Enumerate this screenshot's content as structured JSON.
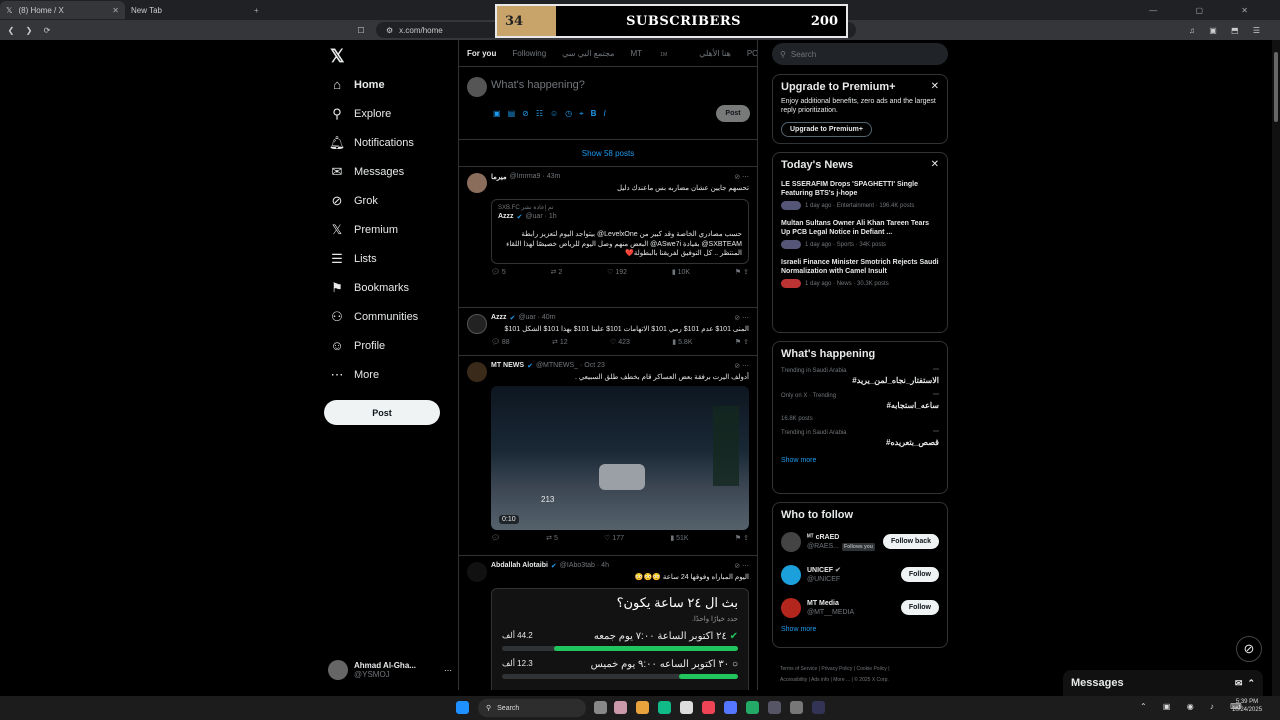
{
  "browser": {
    "tabs": [
      {
        "label": "(8) Home / X"
      },
      {
        "label": "New Tab"
      }
    ],
    "url": "x.com/home"
  },
  "overlay": {
    "current": "34",
    "label": "SUBSCRIBERS",
    "goal": "200",
    "progress": 0.17
  },
  "nav": {
    "items": [
      {
        "label": "Home",
        "icon": "home-icon"
      },
      {
        "label": "Explore",
        "icon": "search-icon"
      },
      {
        "label": "Notifications",
        "icon": "bell-icon"
      },
      {
        "label": "Messages",
        "icon": "envelope-icon"
      },
      {
        "label": "Grok",
        "icon": "grok-icon"
      },
      {
        "label": "Premium",
        "icon": "x-icon"
      },
      {
        "label": "Lists",
        "icon": "list-icon"
      },
      {
        "label": "Bookmarks",
        "icon": "bookmark-icon"
      },
      {
        "label": "Communities",
        "icon": "communities-icon"
      },
      {
        "label": "Profile",
        "icon": "person-icon"
      },
      {
        "label": "More",
        "icon": "more-icon"
      }
    ],
    "post_label": "Post",
    "account": {
      "name": "Ahmad Al-Gha...",
      "handle": "@YSMOJ"
    }
  },
  "feed": {
    "tabs": [
      "For you",
      "Following",
      "مجتمع البي سي",
      "MT",
      "هنا الأهلي",
      "POWR | باور"
    ],
    "tab_mt_badge": "1M",
    "composer_placeholder": "What's happening?",
    "composer_post": "Post",
    "show_posts": "Show 58 posts",
    "tweets": [
      {
        "name": "ميرما",
        "handle": "@Imrma9",
        "time": "43m",
        "text": "تحسهم جايين عشان مضاربه بس ماعندك دليل",
        "quote": {
          "repost": "SXB.FC تم إعادة نشر",
          "name": "Azzz",
          "handle": "@uar",
          "time": "1h",
          "text": "حسب مصادري الخاصة وقد كبير من LevelxOne@ بيتواجد اليوم لتعزيز رابطة SXBTEAM@ بقيادة ASwe7i@ البعض منهم وصل اليوم للرياض خصيصًا لهذا اللقاء المنتظر .. كل التوفيق لفريقنا بالبطولة❤️"
        },
        "stats": {
          "replies": "5",
          "reposts": "2",
          "likes": "192",
          "views": "10K"
        }
      },
      {
        "name": "Azzz",
        "handle": "@uar",
        "time": "40m",
        "text": "المنى 101$ عدم 101$ رمي 101$ الاتهامات 101$ علينا 101$ بهذا 101$ الشكل 101$",
        "stats": {
          "replies": "88",
          "reposts": "12",
          "likes": "423",
          "views": "5.8K"
        }
      },
      {
        "name": "MT NEWS",
        "handle": "@MTNEWS_",
        "time": "Oct 23",
        "text": "أدولف اليرت برفقة بعض العساكر قام بخطف طلق السبيعي .",
        "video_time": "0:10",
        "video_counter": "213",
        "stats": {
          "replies": "",
          "reposts": "5",
          "likes": "177",
          "views": "51K"
        }
      },
      {
        "name": "Abdallah Alotaibi",
        "handle": "@IAbo3tab",
        "time": "4h",
        "text": "اليوم المباراه وفوقها 24 ساعة 😳😳😳",
        "poll": {
          "question": "بث ال ٢٤ ساعة يكون؟",
          "hint": "حدد خيارًا واحدًا.",
          "options": [
            {
              "label": "٢٤ اكتوبر الساعة ٧:٠٠ يوم جمعه",
              "count": "44.2 ألف",
              "share": 0.78
            },
            {
              "label": "٣٠ اكتوبر الساعه ٩:٠٠ يوم خميس",
              "count": "12.3 ألف",
              "share": 0.25
            }
          ]
        }
      }
    ]
  },
  "right": {
    "search_placeholder": "Search",
    "premium": {
      "title": "Upgrade to Premium+",
      "text": "Enjoy additional benefits, zero ads and the largest reply prioritization.",
      "button": "Upgrade to Premium+"
    },
    "news": {
      "title": "Today's News",
      "items": [
        {
          "title": "LE SSERAFIM Drops 'SPAGHETTI' Single Featuring BTS's j-hope",
          "meta": "1 day ago · Entertainment · 196.4K posts"
        },
        {
          "title": "Multan Sultans Owner Ali Khan Tareen Tears Up PCB Legal Notice in Defiant ...",
          "meta": "1 day ago · Sports · 34K posts"
        },
        {
          "title": "Israeli Finance Minister Smotrich Rejects Saudi Normalization with Camel Insult",
          "meta": "1 day ago · News · 30.3K posts"
        }
      ]
    },
    "happening": {
      "title": "What's happening",
      "trends": [
        {
          "context": "Trending in Saudi Arabia",
          "tag": "#الاستفتار_نجاه_لمن_يريد",
          "count": ""
        },
        {
          "context": "Only on X · Trending",
          "tag": "#ساعه_استجابه",
          "count": "16.8K posts"
        },
        {
          "context": "Trending in Saudi Arabia",
          "tag": "#قصص_بتعريده",
          "count": ""
        }
      ],
      "show_more": "Show more"
    },
    "follow": {
      "title": "Who to follow",
      "people": [
        {
          "name": "ᴹᵀ cRAED",
          "handle": "@RAES...",
          "badge": "Follows you",
          "button": "Follow back",
          "color": "#444"
        },
        {
          "name": "UNICEF",
          "handle": "@UNICEF",
          "badge": "",
          "button": "Follow",
          "color": "#1ca0dc"
        },
        {
          "name": "MT Media",
          "handle": "@MT__MEDIA",
          "badge": "",
          "button": "Follow",
          "color": "#b3261e"
        }
      ],
      "show_more": "Show more"
    },
    "footer": [
      "Terms of Service",
      "Privacy Policy",
      "Cookie Policy",
      "Accessibility",
      "Ads info",
      "More ...",
      "© 2025 X Corp."
    ]
  },
  "messages_label": "Messages",
  "taskbar": {
    "search": "Search",
    "time": "5:39 PM",
    "date": "10/24/2025"
  }
}
